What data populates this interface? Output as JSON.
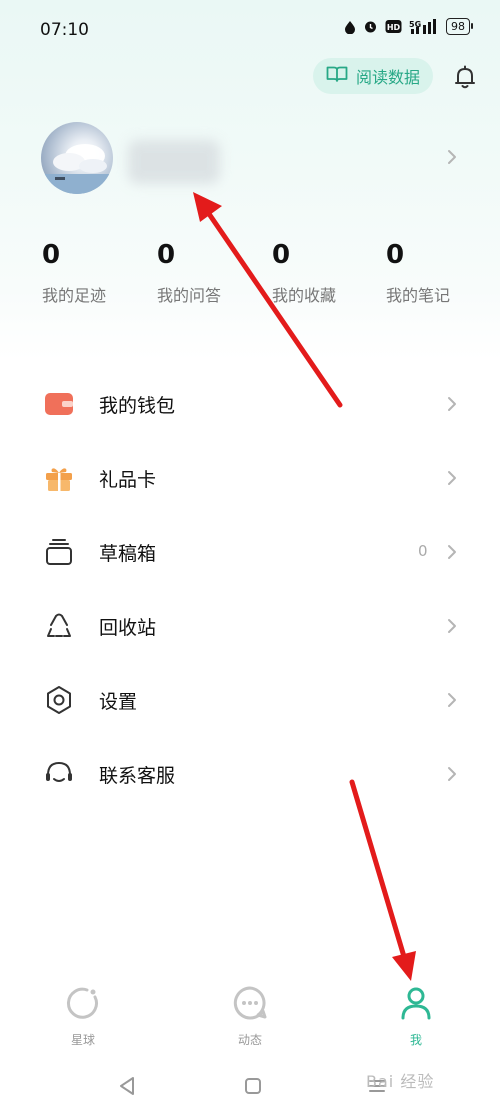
{
  "status_bar": {
    "time": "07:10",
    "network": "5G",
    "hd": "HD",
    "battery": "98"
  },
  "header": {
    "read_data_label": "阅读数据"
  },
  "profile": {
    "username": ""
  },
  "stats": [
    {
      "value": "0",
      "label": "我的足迹"
    },
    {
      "value": "0",
      "label": "我的问答"
    },
    {
      "value": "0",
      "label": "我的收藏"
    },
    {
      "value": "0",
      "label": "我的笔记"
    }
  ],
  "menu": [
    {
      "label": "我的钱包",
      "icon": "wallet-icon",
      "value": ""
    },
    {
      "label": "礼品卡",
      "icon": "gift-icon",
      "value": ""
    },
    {
      "label": "草稿箱",
      "icon": "drafts-icon",
      "value": "0"
    },
    {
      "label": "回收站",
      "icon": "recycle-icon",
      "value": ""
    },
    {
      "label": "设置",
      "icon": "settings-icon",
      "value": ""
    },
    {
      "label": "联系客服",
      "icon": "headset-icon",
      "value": ""
    }
  ],
  "tabs": [
    {
      "label": "星球",
      "icon": "planet-icon",
      "active": false
    },
    {
      "label": "动态",
      "icon": "chat-icon",
      "active": false
    },
    {
      "label": "我",
      "icon": "person-icon",
      "active": true
    }
  ],
  "watermark": "Bai 经验",
  "colors": {
    "accent": "#2eb894",
    "accent_bg": "#d9f3ec",
    "arrow": "#e31b1b",
    "wallet": "#f0705a",
    "gift": "#f3a04b"
  }
}
